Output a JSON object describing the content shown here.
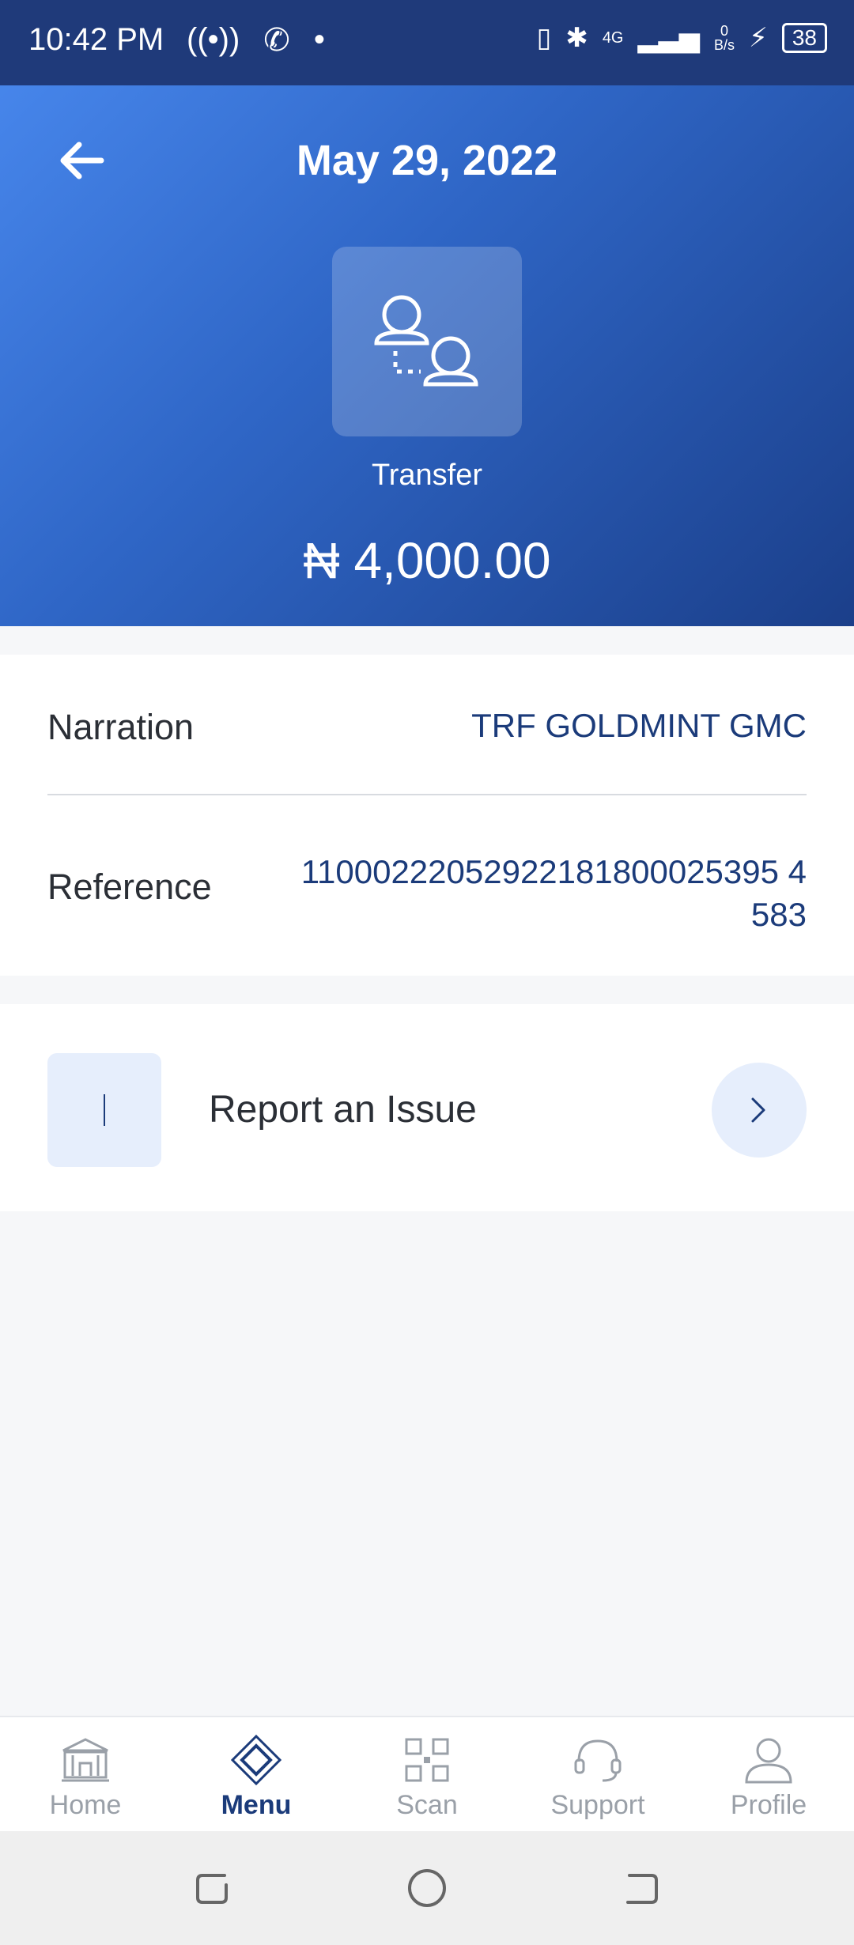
{
  "status_bar": {
    "time": "10:42 PM",
    "network": "4G",
    "speed_value": "0",
    "speed_unit": "B/s",
    "battery": "38"
  },
  "header": {
    "title": "May 29, 2022",
    "transaction_type": "Transfer",
    "amount": "₦ 4,000.00"
  },
  "details": {
    "narration_label": "Narration",
    "narration_value": "TRF GOLDMINT GMC",
    "reference_label": "Reference",
    "reference_value_line1": "11000222052922181800025395 4",
    "reference_value_line2": "583"
  },
  "report": {
    "label": "Report an Issue"
  },
  "bottom_nav": {
    "items": [
      {
        "label": "Home",
        "icon": "bank-icon"
      },
      {
        "label": "Menu",
        "icon": "diamond-menu-icon"
      },
      {
        "label": "Scan",
        "icon": "qr-scan-icon"
      },
      {
        "label": "Support",
        "icon": "headset-icon"
      },
      {
        "label": "Profile",
        "icon": "person-icon"
      }
    ],
    "active": "Menu"
  },
  "colors": {
    "primary": "#1b3b7a",
    "header_gradient_start": "#4a8af0",
    "header_gradient_end": "#1b3f8a",
    "accent_light": "#e6eefc"
  }
}
